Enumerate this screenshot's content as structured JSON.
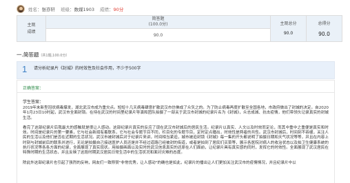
{
  "header": {
    "name_label": "姓名：",
    "name_value": "张亦轩",
    "class_label": "班级：",
    "class_value": "数媒1903",
    "score_label": "成绩：",
    "score_value": "90分"
  },
  "score_table": {
    "row_label": "主观\n成绩",
    "col_header": "简答题\n(100.0分)",
    "col_value": "90.0",
    "subjective_label": "主观总分",
    "subjective_value": "90.0",
    "total_label": "总得分",
    "total_value": "90.0"
  },
  "section": {
    "title": "一.简答题",
    "note": "（共1题,100.0分）"
  },
  "question": {
    "number": "1",
    "text": "请分析纪录片《封城》的时效性及社会作用，不少于500字"
  },
  "answer": {
    "correct_label": "正确答案：",
    "student_label": "学生答案：",
    "para1": "2019年末新型冠状病毒爆发，湖北武汉市成为重灾点。短短十几天病毒肆意扩散武汉市仿佛成了众矢之的。为了防止病毒再度扩散至全国各地，市政府做出了封城的决定。自2020年1月23日10时起，武汉市全面封锁。在待在武汉的时间里纪录片导演和团队拍摄了一部关于武汉市封城的纪录片名为《封城》，众志成城、抗击疫情，他们带领头记录真实的封城生活。",
    "para2": "看完了这部纪录片后我最大的感触就是很让人感动。这部纪录片真实的反应了现在武汉市封城后的居民生活。纪录片以真实、人文以及时效而定论，而其中重中之重便是真实和时效。时间是纪录片的第一要素，它与社会新闻有着联系，它与社会专题节目不同，栏目化的专题节目，定时定点播出，时效性是两者的共性。武汉市封城后，时间刻不容缓，关注人民的生活以及他们是否在近期的生活状况。武汉市被封城后对于纪录片来讲，时间相当紧迫，城市被迫封锁《封城》每一集的开头都说明了拍摄日期和天气状况等等，并且在内容上时刻与封城前后的联系并进行，无论是拍摄自己接送医护人员还是并不经过道路已经被封的街道，或者是拍到了居民们买菜等，展示各医院对病人的收治状态以及拍卫生健康系统的执行状况等各各方面的纪录，全面展现了真实现状。用拍摄画面以及实时的武汉信息真实的还原在人们面前，让纪录片具有真实感的同时，发挥它的时效性。全面展现了武汉居民在特殊时期的生活状态，并且反映了这段时期武汉居民日常生活中的生活状况和面对灾难的态度。",
    "para3": "除此外这部纪录片也引起了强烈的反响，网友们一致称赞\"非常优秀，让人感动\"的确也是如此，纪录片的播出让人们更加关注武汉市的疫情情况，并且纪录片中以"
  }
}
